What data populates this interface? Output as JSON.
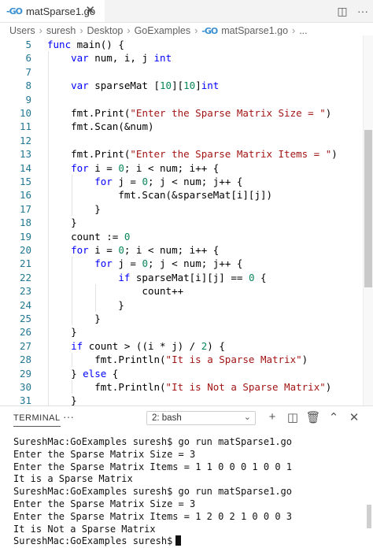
{
  "tab": {
    "icon": "go-file-icon",
    "label": "matSparse1.go"
  },
  "breadcrumb": [
    "Users",
    "suresh",
    "Desktop",
    "GoExamples",
    "matSparse1.go",
    "..."
  ],
  "editor": {
    "lines": [
      {
        "n": "5",
        "t": "func main() {"
      },
      {
        "n": "6",
        "t": "    var num, i, j int"
      },
      {
        "n": "7",
        "t": ""
      },
      {
        "n": "8",
        "t": "    var sparseMat [10][10]int"
      },
      {
        "n": "9",
        "t": ""
      },
      {
        "n": "10",
        "t": "    fmt.Print(\"Enter the Sparse Matrix Size = \")"
      },
      {
        "n": "11",
        "t": "    fmt.Scan(&num)"
      },
      {
        "n": "12",
        "t": ""
      },
      {
        "n": "13",
        "t": "    fmt.Print(\"Enter the Sparse Matrix Items = \")"
      },
      {
        "n": "14",
        "t": "    for i = 0; i < num; i++ {"
      },
      {
        "n": "15",
        "t": "        for j = 0; j < num; j++ {"
      },
      {
        "n": "16",
        "t": "            fmt.Scan(&sparseMat[i][j])"
      },
      {
        "n": "17",
        "t": "        }"
      },
      {
        "n": "18",
        "t": "    }"
      },
      {
        "n": "19",
        "t": "    count := 0"
      },
      {
        "n": "20",
        "t": "    for i = 0; i < num; i++ {"
      },
      {
        "n": "21",
        "t": "        for j = 0; j < num; j++ {"
      },
      {
        "n": "22",
        "t": "            if sparseMat[i][j] == 0 {"
      },
      {
        "n": "23",
        "t": "                count++"
      },
      {
        "n": "24",
        "t": "            }"
      },
      {
        "n": "25",
        "t": "        }"
      },
      {
        "n": "26",
        "t": "    }"
      },
      {
        "n": "27",
        "t": "    if count > ((i * j) / 2) {"
      },
      {
        "n": "28",
        "t": "        fmt.Println(\"It is a Sparse Matrix\")"
      },
      {
        "n": "29",
        "t": "    } else {"
      },
      {
        "n": "30",
        "t": "        fmt.Println(\"It is Not a Sparse Matrix\")"
      },
      {
        "n": "31",
        "t": "    }"
      }
    ]
  },
  "panel": {
    "tab_label": "TERMINAL",
    "more": "···",
    "shell_select": "2: bash",
    "terminal_lines": [
      "SureshMac:GoExamples suresh$ go run matSparse1.go",
      "Enter the Sparse Matrix Size = 3",
      "Enter the Sparse Matrix Items = 1 1 0 0 0 1 0 0 1",
      "It is a Sparse Matrix",
      "SureshMac:GoExamples suresh$ go run matSparse1.go",
      "Enter the Sparse Matrix Size = 3",
      "Enter the Sparse Matrix Items = 1 2 0 2 1 0 0 0 3",
      "It is Not a Sparse Matrix",
      "SureshMac:GoExamples suresh$"
    ]
  },
  "colors": {
    "keyword": "#0000ff",
    "number": "#098658",
    "string": "#a31515",
    "line_number": "#237893",
    "go_icon": "#3a8fd0"
  }
}
